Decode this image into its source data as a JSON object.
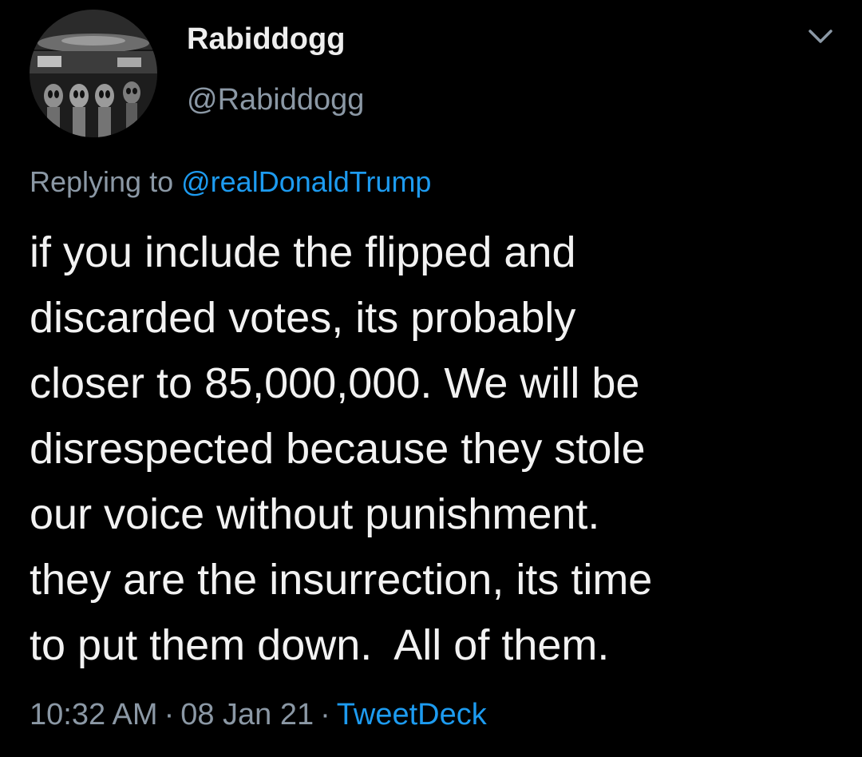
{
  "tweet": {
    "display_name": "Rabiddogg",
    "handle": "@Rabiddogg",
    "replying_prefix": "Replying to",
    "replying_to": "@realDonaldTrump",
    "text_lines": [
      "if you include the flipped and",
      "discarded votes, its probably",
      "closer to 85,000,000. We will be",
      "disrespected because they stole",
      "our voice without punishment.",
      "they are the insurrection, its time",
      "to put them down.  All of them."
    ],
    "time": "10:32 AM",
    "separator": "·",
    "date": "08 Jan 21",
    "source": "TweetDeck",
    "avatar_icon": "avatar-alien-image",
    "menu_icon": "chevron-down-icon"
  },
  "colors": {
    "background": "#000000",
    "text": "#f2f2f2",
    "secondary": "#8b98a5",
    "accent": "#1d9bf0"
  }
}
